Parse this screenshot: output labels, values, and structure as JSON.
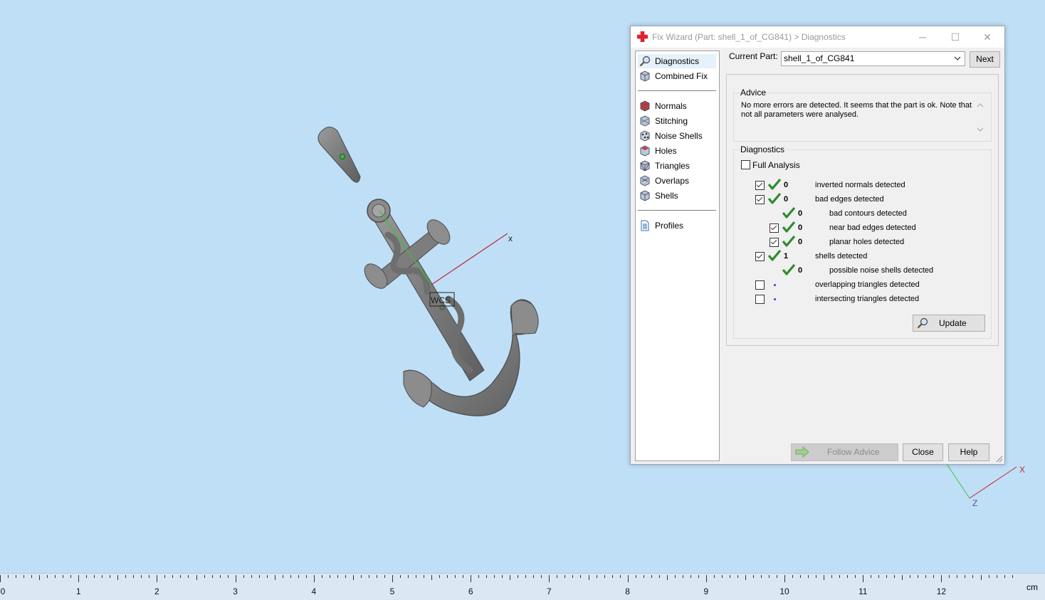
{
  "window": {
    "title": "Fix Wizard (Part: shell_1_of_CG841) > Diagnostics",
    "minimize": "─",
    "maximize": "☐",
    "close": "✕"
  },
  "sidebar": {
    "items": [
      {
        "label": "Diagnostics",
        "icon": "magnifier-icon"
      },
      {
        "label": "Combined Fix",
        "icon": "cube-icon"
      },
      {
        "label": "Normals",
        "icon": "normals-cube-icon"
      },
      {
        "label": "Stitching",
        "icon": "stitching-cube-icon"
      },
      {
        "label": "Noise Shells",
        "icon": "noise-shells-icon"
      },
      {
        "label": "Holes",
        "icon": "holes-cube-icon"
      },
      {
        "label": "Triangles",
        "icon": "triangles-cube-icon"
      },
      {
        "label": "Overlaps",
        "icon": "overlaps-cube-icon"
      },
      {
        "label": "Shells",
        "icon": "shells-cube-icon"
      },
      {
        "label": "Profiles",
        "icon": "document-icon"
      }
    ]
  },
  "current_part": {
    "label": "Current Part:",
    "value": "shell_1_of_CG841",
    "next": "Next"
  },
  "advice": {
    "title": "Advice",
    "text": "No more errors are detected. It seems that the part is ok. Note that not all parameters were analysed."
  },
  "diagnostics": {
    "title": "Diagnostics",
    "full_analysis": "Full Analysis",
    "rows": [
      {
        "checkbox": true,
        "checked": true,
        "status": "ok",
        "count": "0",
        "label": "inverted normals detected",
        "indent": 0
      },
      {
        "checkbox": true,
        "checked": true,
        "status": "ok",
        "count": "0",
        "label": "bad edges detected",
        "indent": 0
      },
      {
        "checkbox": false,
        "checked": false,
        "status": "ok",
        "count": "0",
        "label": "bad contours detected",
        "indent": 1
      },
      {
        "checkbox": true,
        "checked": true,
        "status": "ok",
        "count": "0",
        "label": "near bad edges detected",
        "indent": 1
      },
      {
        "checkbox": true,
        "checked": true,
        "status": "ok",
        "count": "0",
        "label": "planar holes detected",
        "indent": 1
      },
      {
        "checkbox": true,
        "checked": true,
        "status": "ok",
        "count": "1",
        "label": "shells detected",
        "indent": 0
      },
      {
        "checkbox": false,
        "checked": false,
        "status": "ok",
        "count": "0",
        "label": "possible noise shells detected",
        "indent": 1
      },
      {
        "checkbox": true,
        "checked": false,
        "status": "pending",
        "count": "",
        "label": "overlapping triangles detected",
        "indent": 0
      },
      {
        "checkbox": true,
        "checked": false,
        "status": "pending",
        "count": "",
        "label": "intersecting triangles detected",
        "indent": 0
      }
    ],
    "update": "Update"
  },
  "buttons": {
    "follow_advice": "Follow Advice",
    "close": "Close",
    "help": "Help"
  },
  "scene": {
    "axis_x": "x",
    "wcs": "WCS",
    "mini_axis_x": "X",
    "mini_axis_z": "Z"
  },
  "ruler": {
    "labels": [
      "0",
      "1",
      "2",
      "3",
      "4",
      "5",
      "6",
      "7",
      "8",
      "9",
      "10",
      "11",
      "12"
    ],
    "unit": "cm"
  },
  "colors": {
    "background": "#bfdff7",
    "check_green": "#2e8b2e",
    "axis_red": "#c0262e",
    "axis_green": "#3cbf3c"
  }
}
